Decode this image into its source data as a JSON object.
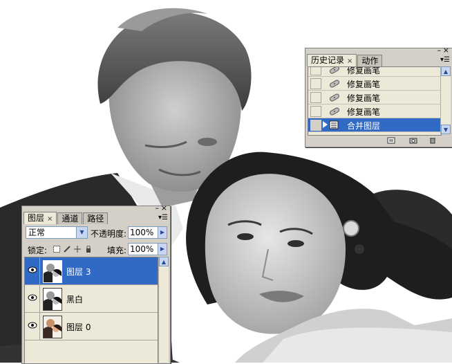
{
  "history_panel": {
    "tabs": [
      {
        "label": "历史记录",
        "active": true
      },
      {
        "label": "动作",
        "active": false
      }
    ],
    "items": [
      {
        "label": "修复画笔",
        "icon": "healing-brush-icon",
        "selected": false
      },
      {
        "label": "修复画笔",
        "icon": "healing-brush-icon",
        "selected": false
      },
      {
        "label": "修复画笔",
        "icon": "healing-brush-icon",
        "selected": false
      },
      {
        "label": "修复画笔",
        "icon": "healing-brush-icon",
        "selected": false
      },
      {
        "label": "合并图层",
        "icon": "merge-layers-icon",
        "selected": true
      }
    ],
    "bottom_icons": [
      "new-document-icon",
      "snapshot-camera-icon",
      "trash-icon"
    ]
  },
  "layers_panel": {
    "tabs": [
      {
        "label": "图层",
        "active": true
      },
      {
        "label": "通道",
        "active": false
      },
      {
        "label": "路径",
        "active": false
      }
    ],
    "blend_mode": "正常",
    "opacity_label": "不透明度:",
    "opacity_value": "100%",
    "lock_label": "锁定:",
    "fill_label": "填充:",
    "fill_value": "100%",
    "layers": [
      {
        "name": "图层 3",
        "visible": true,
        "selected": true
      },
      {
        "name": "黑白",
        "visible": true,
        "selected": false
      },
      {
        "name": "图层 0",
        "visible": true,
        "selected": false
      }
    ]
  },
  "colors": {
    "panel_bg": "#d4d0c8",
    "list_bg": "#ece9d8",
    "selection": "#316ac5"
  }
}
